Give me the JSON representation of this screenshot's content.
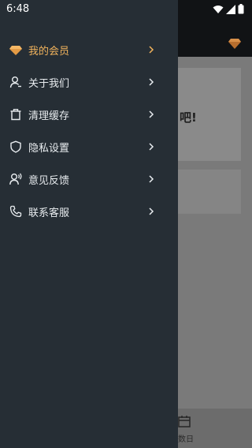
{
  "status_bar": {
    "time": "6:48"
  },
  "menu": {
    "items": [
      {
        "label": "我的会员",
        "icon": "diamond-icon",
        "active": true
      },
      {
        "label": "关于我们",
        "icon": "user-icon"
      },
      {
        "label": "清理缓存",
        "icon": "trash-icon"
      },
      {
        "label": "隐私设置",
        "icon": "shield-icon"
      },
      {
        "label": "意见反馈",
        "icon": "feedback-user-icon"
      },
      {
        "label": "联系客服",
        "icon": "phone-icon"
      }
    ]
  },
  "background": {
    "card_text": "吧!",
    "tab_label": "数日"
  },
  "colors": {
    "drawer_bg": "#262e35",
    "accent": "#f1b35c",
    "text": "#e8ecef"
  }
}
